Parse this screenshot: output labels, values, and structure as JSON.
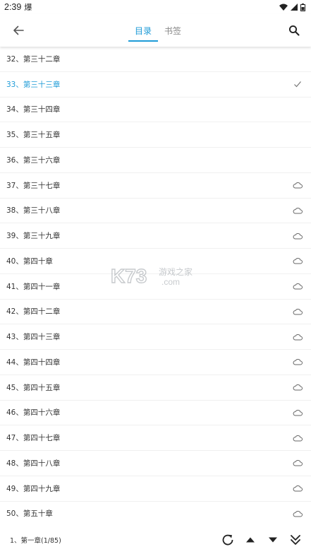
{
  "status_bar": {
    "time": "2:39",
    "app_glyph": "爆",
    "icons": [
      "wifi-icon",
      "signal-icon",
      "battery-icon"
    ]
  },
  "toolbar": {
    "tabs": [
      {
        "label": "目录",
        "active": true
      },
      {
        "label": "书签",
        "active": false
      }
    ],
    "accent_color": "#1e9bd7"
  },
  "chapters": [
    {
      "title": "32、第三十二章",
      "status": "none"
    },
    {
      "title": "33、第三十三章",
      "status": "current"
    },
    {
      "title": "34、第三十四章",
      "status": "none"
    },
    {
      "title": "35、第三十五章",
      "status": "none"
    },
    {
      "title": "36、第三十六章",
      "status": "none"
    },
    {
      "title": "37、第三十七章",
      "status": "cloud"
    },
    {
      "title": "38、第三十八章",
      "status": "cloud"
    },
    {
      "title": "39、第三十九章",
      "status": "cloud"
    },
    {
      "title": "40、第四十章",
      "status": "cloud"
    },
    {
      "title": "41、第四十一章",
      "status": "cloud"
    },
    {
      "title": "42、第四十二章",
      "status": "cloud"
    },
    {
      "title": "43、第四十三章",
      "status": "cloud"
    },
    {
      "title": "44、第四十四章",
      "status": "cloud"
    },
    {
      "title": "45、第四十五章",
      "status": "cloud"
    },
    {
      "title": "46、第四十六章",
      "status": "cloud"
    },
    {
      "title": "47、第四十七章",
      "status": "cloud"
    },
    {
      "title": "48、第四十八章",
      "status": "cloud"
    },
    {
      "title": "49、第四十九章",
      "status": "cloud"
    },
    {
      "title": "50、第五十章",
      "status": "cloud"
    }
  ],
  "watermark": {
    "brand": "K73",
    "name": "游戏之家",
    "domain": ".com"
  },
  "bottom_bar": {
    "progress_label": "1、第一章(1/85)",
    "icons": [
      "refresh-icon",
      "scroll-up-icon",
      "scroll-down-icon",
      "scroll-to-end-icon"
    ]
  }
}
